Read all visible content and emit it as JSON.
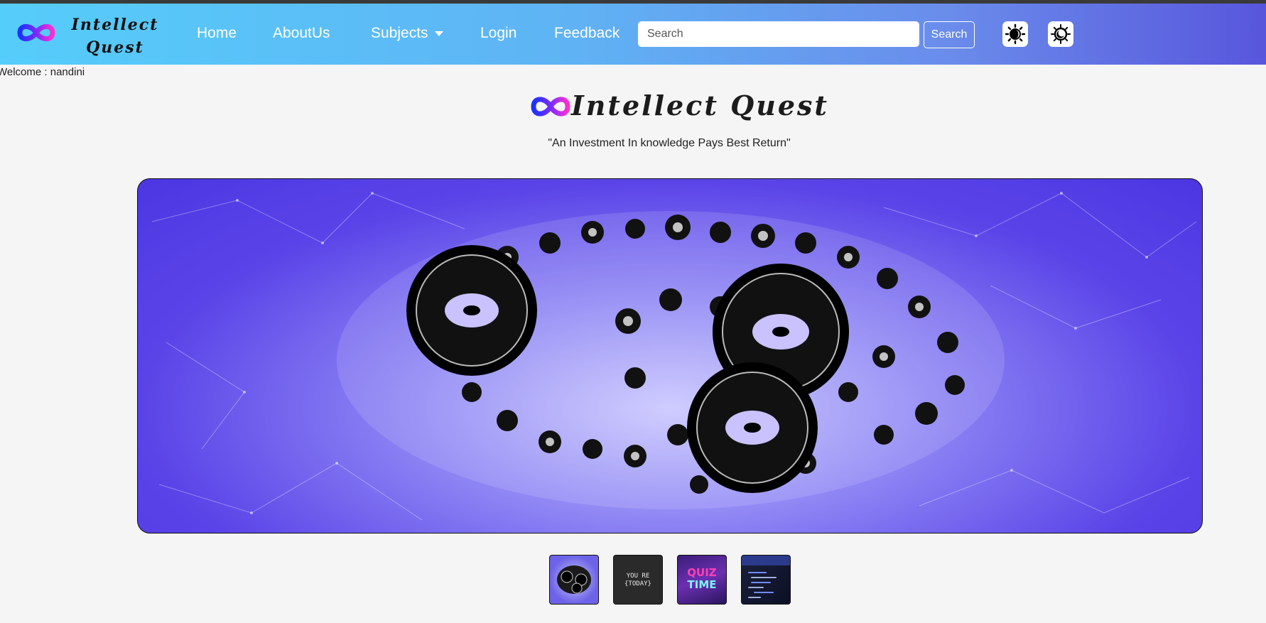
{
  "brand": {
    "name_line1": "Intellect",
    "name_line2": "Quest",
    "logo_icon": "infinity-icon"
  },
  "nav": {
    "home": "Home",
    "about": "AboutUs",
    "subjects": "Subjects",
    "login": "Login",
    "feedback": "Feedback"
  },
  "search": {
    "placeholder": "Search",
    "value": "",
    "button_label": "Search"
  },
  "theme": {
    "light_icon": "sun-icon",
    "dark_icon": "moon-icon"
  },
  "welcome": "Welcome : nandini",
  "hero": {
    "title": "Intellect Quest",
    "tagline": "\"An Investment In knowledge Pays Best Return\""
  },
  "carousel": {
    "active_slide": 1,
    "slide_count": 4,
    "slide_image": "gears-brain-image",
    "thumbnails": [
      {
        "image": "gears-brain-thumbnail"
      },
      {
        "image": "today-quote-thumbnail",
        "text_line1": "YOU RE",
        "text_line2": "{TODAY}"
      },
      {
        "image": "quiz-time-thumbnail",
        "text_line1": "QUIZ",
        "text_line2": "TIME"
      },
      {
        "image": "code-screen-thumbnail"
      }
    ]
  },
  "colors": {
    "navbar_start": "#55cdfa",
    "navbar_end": "#5856dc",
    "carousel_accent": "#4c36e2",
    "logo_blue": "#1a32ff",
    "logo_pink": "#ff2fd0"
  }
}
